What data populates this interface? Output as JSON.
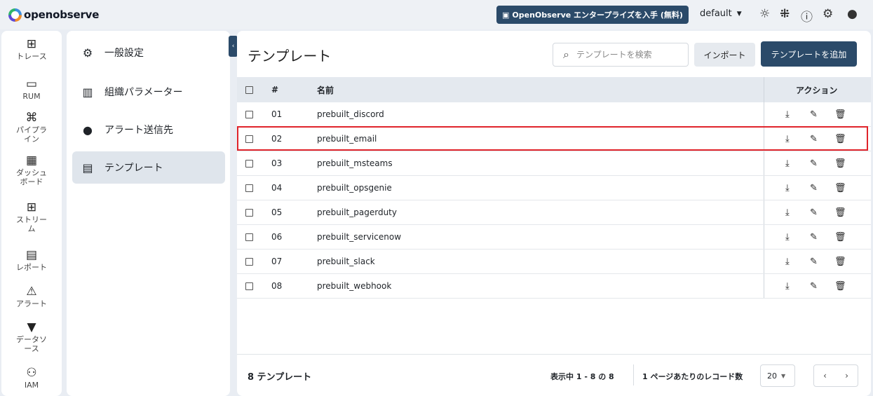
{
  "app": {
    "logo_text": "openobserve"
  },
  "topbar": {
    "enterprise_label": "OpenObserve エンタープライズを入手 (無料)",
    "org_name": "default",
    "icons": [
      "theme-toggle-icon",
      "slack-icon",
      "help-icon",
      "settings-icon",
      "user-icon"
    ]
  },
  "leftnav": [
    {
      "label": "トレース",
      "icon": "traces-icon"
    },
    {
      "label": "RUM",
      "icon": "rum-icon"
    },
    {
      "label": "パイプラ\nイン",
      "icon": "pipeline-icon"
    },
    {
      "label": "ダッシュ\nボード",
      "icon": "dashboard-icon"
    },
    {
      "label": "ストリー\nム",
      "icon": "streams-icon"
    },
    {
      "label": "レポート",
      "icon": "report-icon"
    },
    {
      "label": "アラート",
      "icon": "alert-icon"
    },
    {
      "label": "データソ\nース",
      "icon": "datasource-icon"
    },
    {
      "label": "IAM",
      "icon": "iam-icon"
    }
  ],
  "settings_menu": [
    {
      "label": "一般設定",
      "icon": "gear-icon"
    },
    {
      "label": "組織パラメーター",
      "icon": "building-icon"
    },
    {
      "label": "アラート送信先",
      "icon": "location-icon"
    },
    {
      "label": "テンプレート",
      "icon": "document-icon",
      "active": true
    }
  ],
  "main": {
    "title": "テンプレート",
    "search_placeholder": "テンプレートを検索",
    "import_label": "インポート",
    "add_label": "テンプレートを追加",
    "table": {
      "columns": {
        "num": "#",
        "name": "名前",
        "actions": "アクション"
      },
      "rows": [
        {
          "num": "01",
          "name": "prebuilt_discord"
        },
        {
          "num": "02",
          "name": "prebuilt_email"
        },
        {
          "num": "03",
          "name": "prebuilt_msteams"
        },
        {
          "num": "04",
          "name": "prebuilt_opsgenie"
        },
        {
          "num": "05",
          "name": "prebuilt_pagerduty"
        },
        {
          "num": "06",
          "name": "prebuilt_servicenow"
        },
        {
          "num": "07",
          "name": "prebuilt_slack"
        },
        {
          "num": "08",
          "name": "prebuilt_webhook"
        }
      ]
    },
    "footer": {
      "count_label": "8 テンプレート",
      "range_label": "表示中 1 - 8 の 8",
      "per_page_label": "1 ページあたりのレコード数",
      "per_page_value": "20"
    }
  },
  "colors": {
    "accent": "#2b4a69",
    "highlight": "#e0242b"
  }
}
